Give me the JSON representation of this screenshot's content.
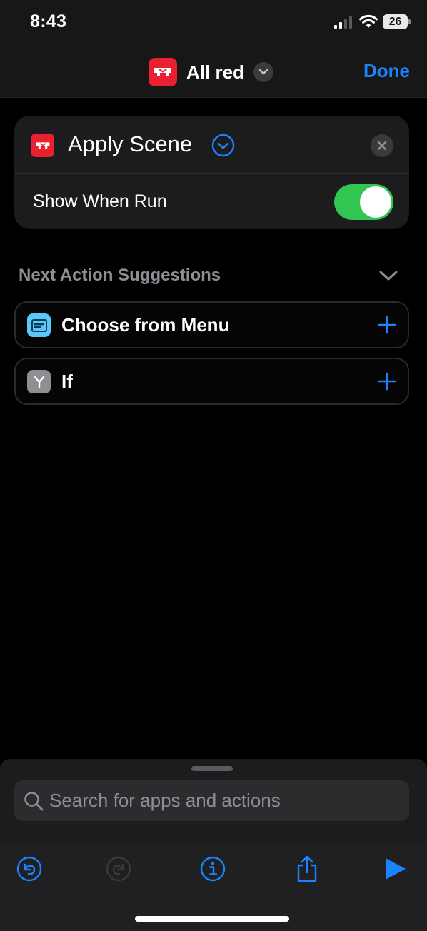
{
  "status_bar": {
    "time": "8:43",
    "battery": "26"
  },
  "nav": {
    "title": "All red",
    "done_label": "Done",
    "app_icon": "yale-logo-icon"
  },
  "action": {
    "title": "Apply Scene",
    "show_when_run_label": "Show When Run",
    "show_when_run": true
  },
  "suggestions": {
    "header": "Next Action Suggestions",
    "items": [
      {
        "label": "Choose from Menu",
        "icon": "menu-icon",
        "color": "#5ac8fa"
      },
      {
        "label": "If",
        "icon": "branch-icon",
        "color": "#8e8e93"
      }
    ]
  },
  "search": {
    "placeholder": "Search for apps and actions"
  },
  "toolbar": {
    "buttons": [
      "undo-icon",
      "redo-icon",
      "info-icon",
      "share-icon",
      "play-icon"
    ]
  },
  "colors": {
    "accent": "#1a84ff",
    "brand": "#ea1f30",
    "toggle_on": "#31c552"
  }
}
